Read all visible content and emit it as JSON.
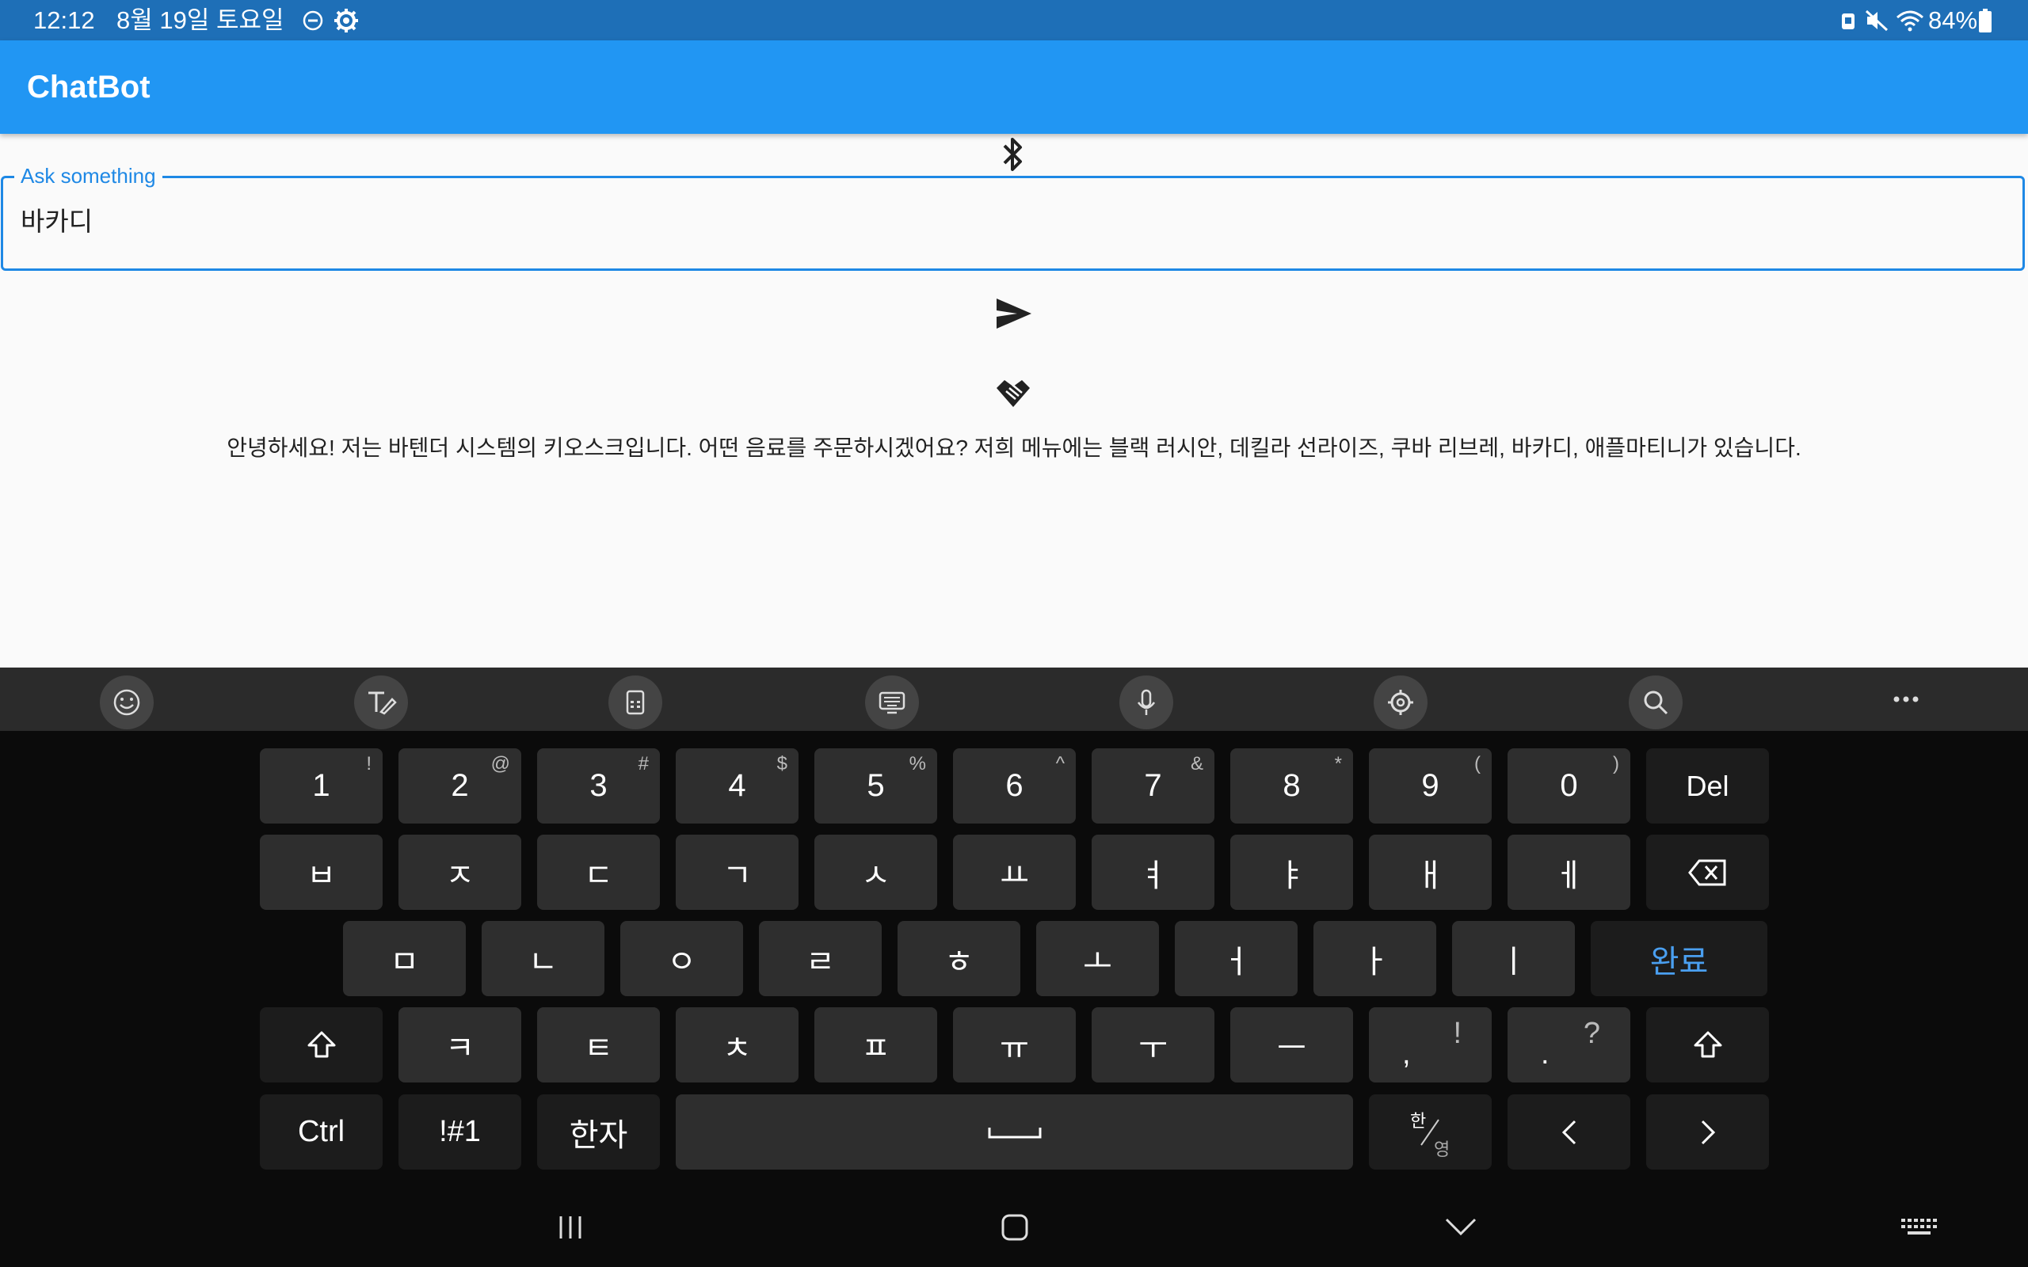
{
  "status_bar": {
    "time": "12:12",
    "date": "8월 19일 토요일",
    "battery": "84%"
  },
  "app_bar": {
    "title": "ChatBot"
  },
  "input": {
    "label": "Ask something",
    "value": "바카디"
  },
  "response": "안녕하세요! 저는 바텐더 시스템의 키오스크입니다. 어떤 음료를 주문하시겠어요? 저희 메뉴에는 블랙 러시안, 데킬라 선라이즈, 쿠바 리브레, 바카디, 애플마티니가 있습니다.",
  "keyboard": {
    "toolbar": [
      "emoji-icon",
      "handwriting-icon",
      "one-hand-icon",
      "keyboard-layout-icon",
      "mic-icon",
      "settings-icon",
      "search-icon",
      "more-icon"
    ],
    "row1": [
      {
        "main": "1",
        "hint": "!"
      },
      {
        "main": "2",
        "hint": "@"
      },
      {
        "main": "3",
        "hint": "#"
      },
      {
        "main": "4",
        "hint": "$"
      },
      {
        "main": "5",
        "hint": "%"
      },
      {
        "main": "6",
        "hint": "^"
      },
      {
        "main": "7",
        "hint": "&"
      },
      {
        "main": "8",
        "hint": "*"
      },
      {
        "main": "9",
        "hint": "("
      },
      {
        "main": "0",
        "hint": ")"
      }
    ],
    "del": "Del",
    "row2": [
      "ㅂ",
      "ㅈ",
      "ㄷ",
      "ㄱ",
      "ㅅ",
      "ㅛ",
      "ㅕ",
      "ㅑ",
      "ㅐ",
      "ㅔ"
    ],
    "row3": [
      "ㅁ",
      "ㄴ",
      "ㅇ",
      "ㄹ",
      "ㅎ",
      "ㅗ",
      "ㅓ",
      "ㅏ",
      "ㅣ"
    ],
    "done": "완료",
    "row4": [
      "ㅋ",
      "ㅌ",
      "ㅊ",
      "ㅍ",
      "ㅠ",
      "ㅜ",
      "ㅡ"
    ],
    "comma": {
      "main": ",",
      "hint": "!"
    },
    "period": {
      "main": ".",
      "hint": "?"
    },
    "ctrl": "Ctrl",
    "symbols": "!#1",
    "hanja": "한자",
    "lang_top": "한",
    "lang_bottom": "영"
  },
  "colors": {
    "status_bar": "#1e6fb7",
    "app_bar": "#2196f3",
    "accent": "#1e88e5",
    "done_key_text": "#4a9ff0"
  }
}
